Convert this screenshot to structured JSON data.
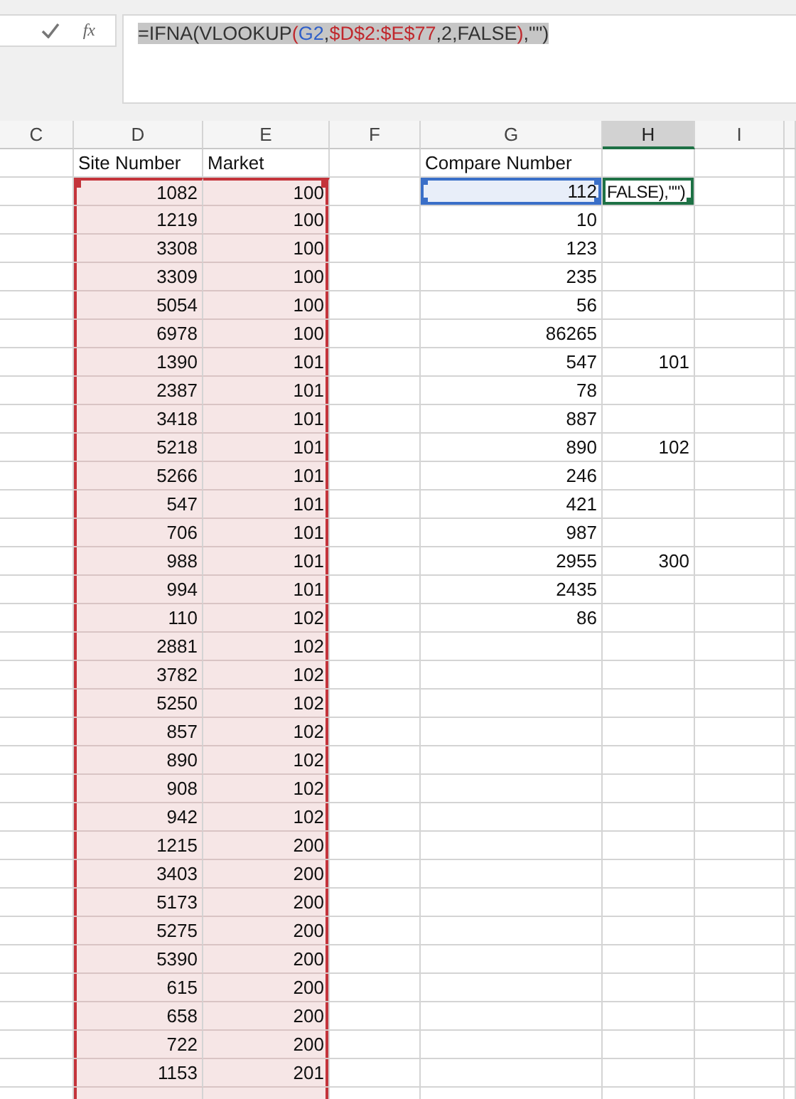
{
  "formula_bar": {
    "function_label": "fx",
    "formula": [
      {
        "text": "=IFNA(VLOOKUP",
        "color": "#333333"
      },
      {
        "text": "(",
        "color": "#c0282d"
      },
      {
        "text": "G2",
        "color": "#2f5fc9"
      },
      {
        "text": ",",
        "color": "#333333"
      },
      {
        "text": "$D$2:$E$77",
        "color": "#c0282d"
      },
      {
        "text": ",2,FALSE",
        "color": "#333333"
      },
      {
        "text": ")",
        "color": "#c0282d"
      },
      {
        "text": ",\"\")",
        "color": "#333333"
      }
    ]
  },
  "columns": [
    {
      "label": "C",
      "selected": false
    },
    {
      "label": "D",
      "selected": false
    },
    {
      "label": "E",
      "selected": false
    },
    {
      "label": "F",
      "selected": false
    },
    {
      "label": "G",
      "selected": false
    },
    {
      "label": "H",
      "selected": true
    },
    {
      "label": "I",
      "selected": false
    }
  ],
  "headers": {
    "site_number": "Site Number",
    "market": "Market",
    "compare_number": "Compare Number"
  },
  "rows": [
    {
      "site_number": "1082",
      "market": "100",
      "compare_number": "112",
      "result": "FALSE),\"\")",
      "in_lookup_range": true,
      "compare_selected": true,
      "result_active": true
    },
    {
      "site_number": "1219",
      "market": "100",
      "compare_number": "10",
      "in_lookup_range": true,
      "compare_selected": false,
      "result_active": false
    },
    {
      "site_number": "3308",
      "market": "100",
      "compare_number": "123",
      "in_lookup_range": true,
      "compare_selected": false,
      "result_active": false
    },
    {
      "site_number": "3309",
      "market": "100",
      "compare_number": "235",
      "in_lookup_range": true,
      "compare_selected": false,
      "result_active": false
    },
    {
      "site_number": "5054",
      "market": "100",
      "compare_number": "56",
      "in_lookup_range": true,
      "compare_selected": false,
      "result_active": false
    },
    {
      "site_number": "6978",
      "market": "100",
      "compare_number": "86265",
      "in_lookup_range": true,
      "compare_selected": false,
      "result_active": false
    },
    {
      "site_number": "1390",
      "market": "101",
      "compare_number": "547",
      "result": "101",
      "in_lookup_range": true,
      "compare_selected": false,
      "result_active": false
    },
    {
      "site_number": "2387",
      "market": "101",
      "compare_number": "78",
      "in_lookup_range": true,
      "compare_selected": false,
      "result_active": false
    },
    {
      "site_number": "3418",
      "market": "101",
      "compare_number": "887",
      "in_lookup_range": true,
      "compare_selected": false,
      "result_active": false
    },
    {
      "site_number": "5218",
      "market": "101",
      "compare_number": "890",
      "result": "102",
      "in_lookup_range": true,
      "compare_selected": false,
      "result_active": false
    },
    {
      "site_number": "5266",
      "market": "101",
      "compare_number": "246",
      "in_lookup_range": true,
      "compare_selected": false,
      "result_active": false
    },
    {
      "site_number": "547",
      "market": "101",
      "compare_number": "421",
      "in_lookup_range": true,
      "compare_selected": false,
      "result_active": false
    },
    {
      "site_number": "706",
      "market": "101",
      "compare_number": "987",
      "in_lookup_range": true,
      "compare_selected": false,
      "result_active": false
    },
    {
      "site_number": "988",
      "market": "101",
      "compare_number": "2955",
      "result": "300",
      "in_lookup_range": true,
      "compare_selected": false,
      "result_active": false
    },
    {
      "site_number": "994",
      "market": "101",
      "compare_number": "2435",
      "in_lookup_range": true,
      "compare_selected": false,
      "result_active": false
    },
    {
      "site_number": "110",
      "market": "102",
      "compare_number": "86",
      "in_lookup_range": true,
      "compare_selected": false,
      "result_active": false
    },
    {
      "site_number": "2881",
      "market": "102",
      "in_lookup_range": true,
      "compare_selected": false,
      "result_active": false
    },
    {
      "site_number": "3782",
      "market": "102",
      "in_lookup_range": true,
      "compare_selected": false,
      "result_active": false
    },
    {
      "site_number": "5250",
      "market": "102",
      "in_lookup_range": true,
      "compare_selected": false,
      "result_active": false
    },
    {
      "site_number": "857",
      "market": "102",
      "in_lookup_range": true,
      "compare_selected": false,
      "result_active": false
    },
    {
      "site_number": "890",
      "market": "102",
      "in_lookup_range": true,
      "compare_selected": false,
      "result_active": false
    },
    {
      "site_number": "908",
      "market": "102",
      "in_lookup_range": true,
      "compare_selected": false,
      "result_active": false
    },
    {
      "site_number": "942",
      "market": "102",
      "in_lookup_range": true,
      "compare_selected": false,
      "result_active": false
    },
    {
      "site_number": "1215",
      "market": "200",
      "in_lookup_range": true,
      "compare_selected": false,
      "result_active": false
    },
    {
      "site_number": "3403",
      "market": "200",
      "in_lookup_range": true,
      "compare_selected": false,
      "result_active": false
    },
    {
      "site_number": "5173",
      "market": "200",
      "in_lookup_range": true,
      "compare_selected": false,
      "result_active": false
    },
    {
      "site_number": "5275",
      "market": "200",
      "in_lookup_range": true,
      "compare_selected": false,
      "result_active": false
    },
    {
      "site_number": "5390",
      "market": "200",
      "in_lookup_range": true,
      "compare_selected": false,
      "result_active": false
    },
    {
      "site_number": "615",
      "market": "200",
      "in_lookup_range": true,
      "compare_selected": false,
      "result_active": false
    },
    {
      "site_number": "658",
      "market": "200",
      "in_lookup_range": true,
      "compare_selected": false,
      "result_active": false
    },
    {
      "site_number": "722",
      "market": "200",
      "in_lookup_range": true,
      "compare_selected": false,
      "result_active": false
    },
    {
      "site_number": "1153",
      "market": "201",
      "in_lookup_range": true,
      "compare_selected": false,
      "result_active": false
    }
  ]
}
